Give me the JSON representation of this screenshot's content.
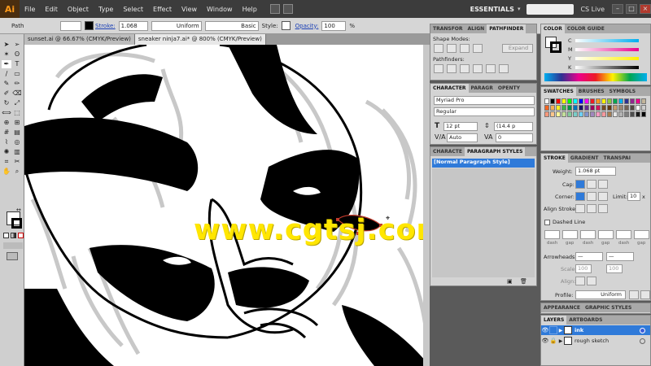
{
  "app": {
    "logo": "Ai",
    "workspace": "ESSENTIALS",
    "cs_live": "CS Live"
  },
  "menu": [
    "File",
    "Edit",
    "Object",
    "Type",
    "Select",
    "Effect",
    "View",
    "Window",
    "Help"
  ],
  "control_bar": {
    "object_type": "Path",
    "stroke_label": "Stroke:",
    "stroke_value": "1.068",
    "profile": "Uniform",
    "brush": "Basic",
    "style_label": "Style:",
    "opacity_label": "Opacity:",
    "opacity_value": "100",
    "opacity_unit": "%"
  },
  "doc_tabs": [
    {
      "label": "sunset.ai @ 66.67% (CMYK/Preview)",
      "active": false
    },
    {
      "label": "sneaker ninja7.ai* @ 800% (CMYK/Preview)",
      "active": true
    }
  ],
  "transform_panel": {
    "tabs": [
      "TRANSFOR",
      "ALIGN",
      "PATHFINDER"
    ],
    "shape_modes": "Shape Modes:",
    "expand": "Expand",
    "pathfinders": "Pathfinders:"
  },
  "character_panel": {
    "tabs": [
      "CHARACTER",
      "PARAGR",
      "OPENTY"
    ],
    "font": "Myriad Pro",
    "style": "Regular",
    "size": "12 pt",
    "leading": "(14.4 p",
    "kerning": "Auto",
    "tracking": "0"
  },
  "para_styles_panel": {
    "tabs": [
      "CHARACTE",
      "PARAGRAPH STYLES"
    ],
    "items": [
      "[Normal Paragraph Style]"
    ]
  },
  "color_panel": {
    "tabs": [
      "COLOR",
      "COLOR GUIDE"
    ],
    "channels": [
      {
        "name": "C",
        "color": "#00aeef"
      },
      {
        "name": "M",
        "color": "#ec008c"
      },
      {
        "name": "Y",
        "color": "#fff200"
      },
      {
        "name": "K",
        "color": "#000000"
      }
    ]
  },
  "swatches_panel": {
    "tabs": [
      "SWATCHES",
      "BRUSHES",
      "SYMBOLS"
    ],
    "colors": [
      "#ffffff",
      "#000000",
      "#ff0000",
      "#ffff00",
      "#00ff00",
      "#00ffff",
      "#0000ff",
      "#ff00ff",
      "#ed1c24",
      "#f7941d",
      "#fff200",
      "#8dc63f",
      "#00a651",
      "#00aeef",
      "#2e3192",
      "#92278f",
      "#ec008c",
      "#c2b59b",
      "#f26522",
      "#f7ac52",
      "#fcee21",
      "#39b54a",
      "#009245",
      "#0072bc",
      "#1b1464",
      "#662d91",
      "#9e005d",
      "#d4145a",
      "#754c24",
      "#603813",
      "#c69c6d",
      "#998675",
      "#736357",
      "#534741",
      "#ffffff",
      "#cccccc",
      "#f7977a",
      "#fdc68a",
      "#fff799",
      "#c4df9b",
      "#82ca9c",
      "#7accc8",
      "#6dcff6",
      "#8393ca",
      "#a187be",
      "#f49ac2",
      "#f6989d",
      "#a67c52",
      "#e6e6e6",
      "#b3b3b3",
      "#808080",
      "#4d4d4d",
      "#1a1a1a",
      "#000000"
    ]
  },
  "stroke_panel": {
    "tabs": [
      "STROKE",
      "GRADIENT",
      "TRANSPAI"
    ],
    "weight_label": "Weight:",
    "weight_value": "1.068 pt",
    "cap_label": "Cap:",
    "corner_label": "Corner:",
    "limit_label": "Limit:",
    "limit_value": "10",
    "limit_unit": "x",
    "align_label": "Align Stroke:",
    "dashed_label": "Dashed Line",
    "dash_labels": [
      "dash",
      "gap",
      "dash",
      "gap",
      "dash",
      "gap"
    ],
    "arrowheads_label": "Arrowheads:",
    "scale_label": "Scale:",
    "scale_values": [
      "100",
      "100"
    ],
    "align_label2": "Align:",
    "profile_label": "Profile:",
    "profile_value": "Uniform"
  },
  "layers_panel": {
    "tabs": [
      "APPEARANCE",
      "GRAPHIC STYLES"
    ],
    "tabs2": [
      "LAYERS",
      "ARTBOARDS"
    ],
    "layers": [
      {
        "name": "ink",
        "selected": true
      },
      {
        "name": "rough sketch",
        "selected": false
      }
    ]
  },
  "watermark": "www.cgtsj.com"
}
